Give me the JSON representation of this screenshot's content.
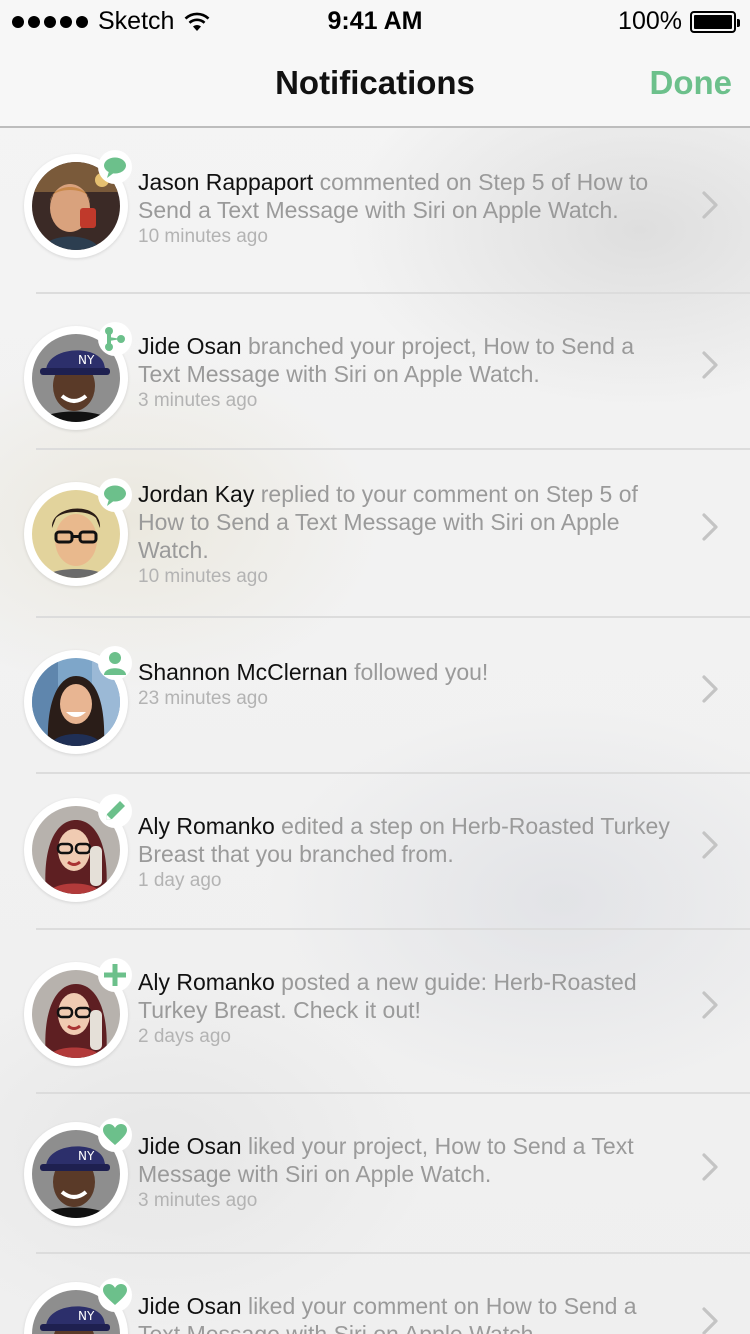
{
  "status_bar": {
    "carrier": "Sketch",
    "time": "9:41 AM",
    "battery": "100%"
  },
  "nav": {
    "title": "Notifications",
    "done_label": "Done"
  },
  "colors": {
    "accent": "#6cc08b",
    "actor_text": "#111111",
    "body_text": "#9a9a9a",
    "time_text": "#b3b3b3"
  },
  "notifications": [
    {
      "actor": "Jason Rappaport",
      "message": " commented on Step 5 of How to Send a Text Message with Siri on Apple Watch.",
      "time": "10 minutes ago",
      "badge_icon": "comment-icon",
      "avatar": "jason-rappaport-avatar"
    },
    {
      "actor": "Jide Osan",
      "message": " branched your project, How to Send a Text Message with Siri on Apple Watch.",
      "time": "3 minutes ago",
      "badge_icon": "branch-icon",
      "avatar": "jide-osan-avatar"
    },
    {
      "actor": "Jordan Kay",
      "message": " replied to your comment on Step 5 of How to Send a Text Message with Siri on Apple Watch.",
      "time": "10 minutes ago",
      "badge_icon": "comment-icon",
      "avatar": "jordan-kay-avatar"
    },
    {
      "actor": "Shannon McClernan",
      "message": " followed you!",
      "time": "23 minutes ago",
      "badge_icon": "person-icon",
      "avatar": "shannon-mcclernan-avatar"
    },
    {
      "actor": "Aly Romanko",
      "message": " edited a step on Herb-Roasted Turkey Breast that you branched from.",
      "time": "1 day ago",
      "badge_icon": "pencil-icon",
      "avatar": "aly-romanko-avatar"
    },
    {
      "actor": "Aly Romanko",
      "message": " posted a new guide: Herb-Roasted Turkey Breast. Check it out!",
      "time": "2 days ago",
      "badge_icon": "plus-icon",
      "avatar": "aly-romanko-avatar"
    },
    {
      "actor": "Jide Osan",
      "message": " liked your project, How to Send a Text Message with Siri on Apple Watch.",
      "time": "3 minutes ago",
      "badge_icon": "heart-icon",
      "avatar": "jide-osan-avatar"
    },
    {
      "actor": "Jide Osan",
      "message": " liked your comment on How to Send a Text Message with Siri on Apple Watch.",
      "time": "",
      "badge_icon": "heart-icon",
      "avatar": "jide-osan-avatar"
    }
  ]
}
